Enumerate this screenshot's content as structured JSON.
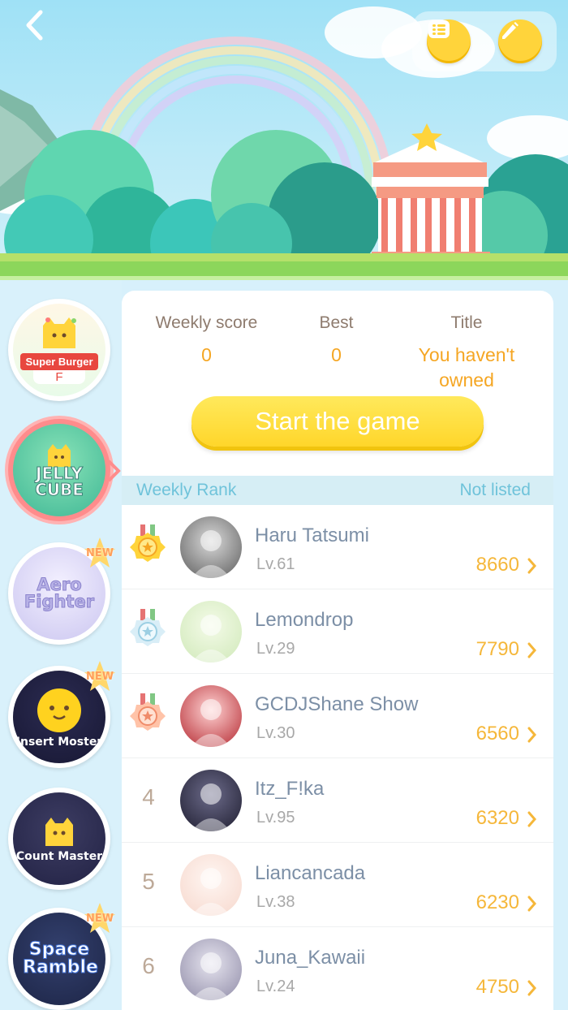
{
  "header": {
    "back_icon": "chevron-left-icon",
    "menu_icon": "list-icon",
    "edit_icon": "pencil-icon"
  },
  "games": [
    {
      "name": "Super Burger",
      "grade": "F",
      "new": false,
      "selected": false
    },
    {
      "name": "JELLY CUBE",
      "new": false,
      "selected": true
    },
    {
      "name": "Aero Fighter",
      "new": true,
      "selected": false
    },
    {
      "name": "Insert Moster",
      "new": true,
      "selected": false
    },
    {
      "name": "Count Master",
      "new": false,
      "selected": false
    },
    {
      "name": "Space Ramble",
      "new": true,
      "selected": false
    }
  ],
  "new_badge_label": "NEW",
  "stats": {
    "weekly_label": "Weekly score",
    "weekly_value": "0",
    "best_label": "Best",
    "best_value": "0",
    "title_label": "Title",
    "title_value": "You haven't owned"
  },
  "start_button": "Start the game",
  "ranking": {
    "header_label": "Weekly Rank",
    "status": "Not listed",
    "rows": [
      {
        "rank": "1",
        "medal": "gold",
        "name": "Haru Tatsumi",
        "level": "Lv.61",
        "score": "8660"
      },
      {
        "rank": "2",
        "medal": "silver",
        "name": "Lemondrop",
        "level": "Lv.29",
        "score": "7790"
      },
      {
        "rank": "3",
        "medal": "bronze",
        "name": "GCDJShane Show",
        "level": "Lv.30",
        "score": "6560"
      },
      {
        "rank": "4",
        "medal": "none",
        "name": "Itz_F!ka",
        "level": "Lv.95",
        "score": "6320"
      },
      {
        "rank": "5",
        "medal": "none",
        "name": "Liancancada",
        "level": "Lv.38",
        "score": "6230"
      },
      {
        "rank": "6",
        "medal": "none",
        "name": "Juna_Kawaii",
        "level": "Lv.24",
        "score": "4750"
      }
    ]
  },
  "colors": {
    "accent": "#ffd43b",
    "score": "#f5b73a",
    "rank_header": "#6fc3da"
  }
}
